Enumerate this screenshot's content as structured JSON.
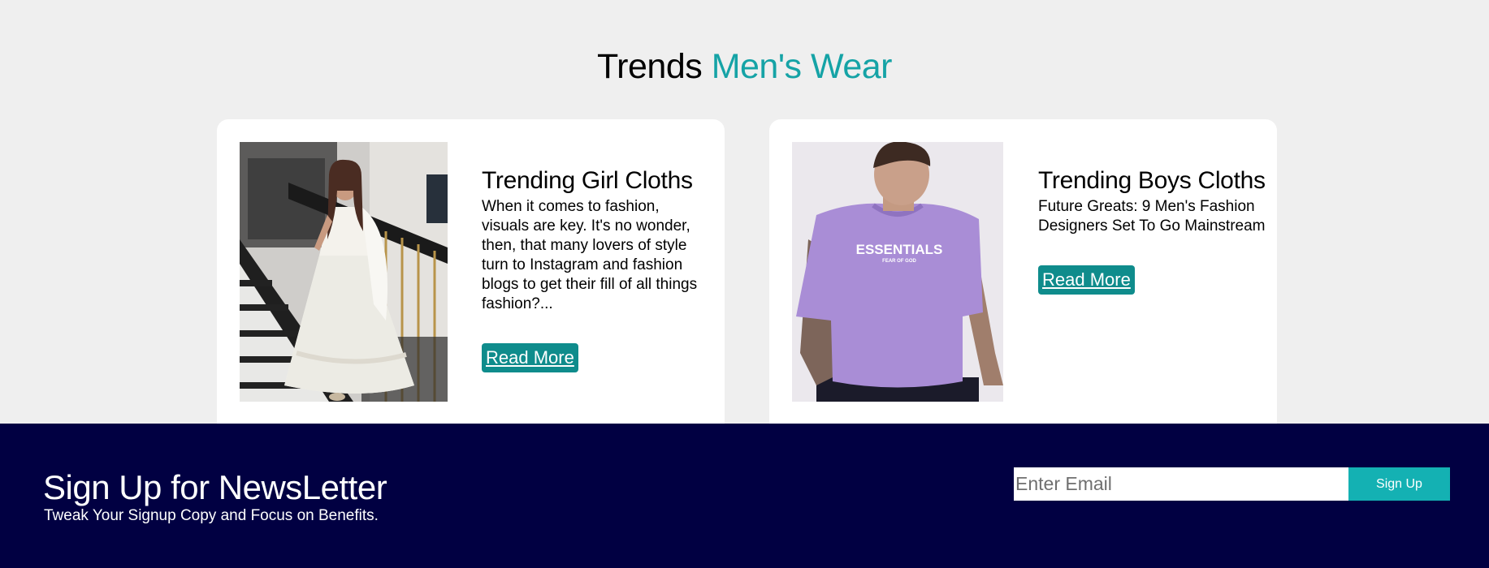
{
  "trends": {
    "title_main": "Trends",
    "title_accent": "Men's Wear",
    "cards": [
      {
        "title": "Trending Girl Cloths",
        "text": "When it comes to fashion, visuals are key. It's no wonder, then, that many lovers of style turn to Instagram and fashion blogs to get their fill of all things fashion?...",
        "button": "Read More"
      },
      {
        "title": "Trending Boys Cloths",
        "text": "Future Greats: 9 Men's Fashion Designers Set To Go Mainstream",
        "button": "Read More",
        "shirt_print": "ESSENTIALS",
        "shirt_print_sub": "FEAR OF GOD"
      }
    ]
  },
  "newsletter": {
    "title": "Sign Up for NewsLetter",
    "subtitle": "Tweak Your Signup Copy and Focus on Benefits.",
    "email_placeholder": "Enter Email",
    "button": "Sign Up"
  },
  "colors": {
    "accent": "#15a3a6",
    "read_more_bg": "#0f8c8c",
    "newsletter_bg": "#010042",
    "signup_button_bg": "#14b1b3"
  }
}
